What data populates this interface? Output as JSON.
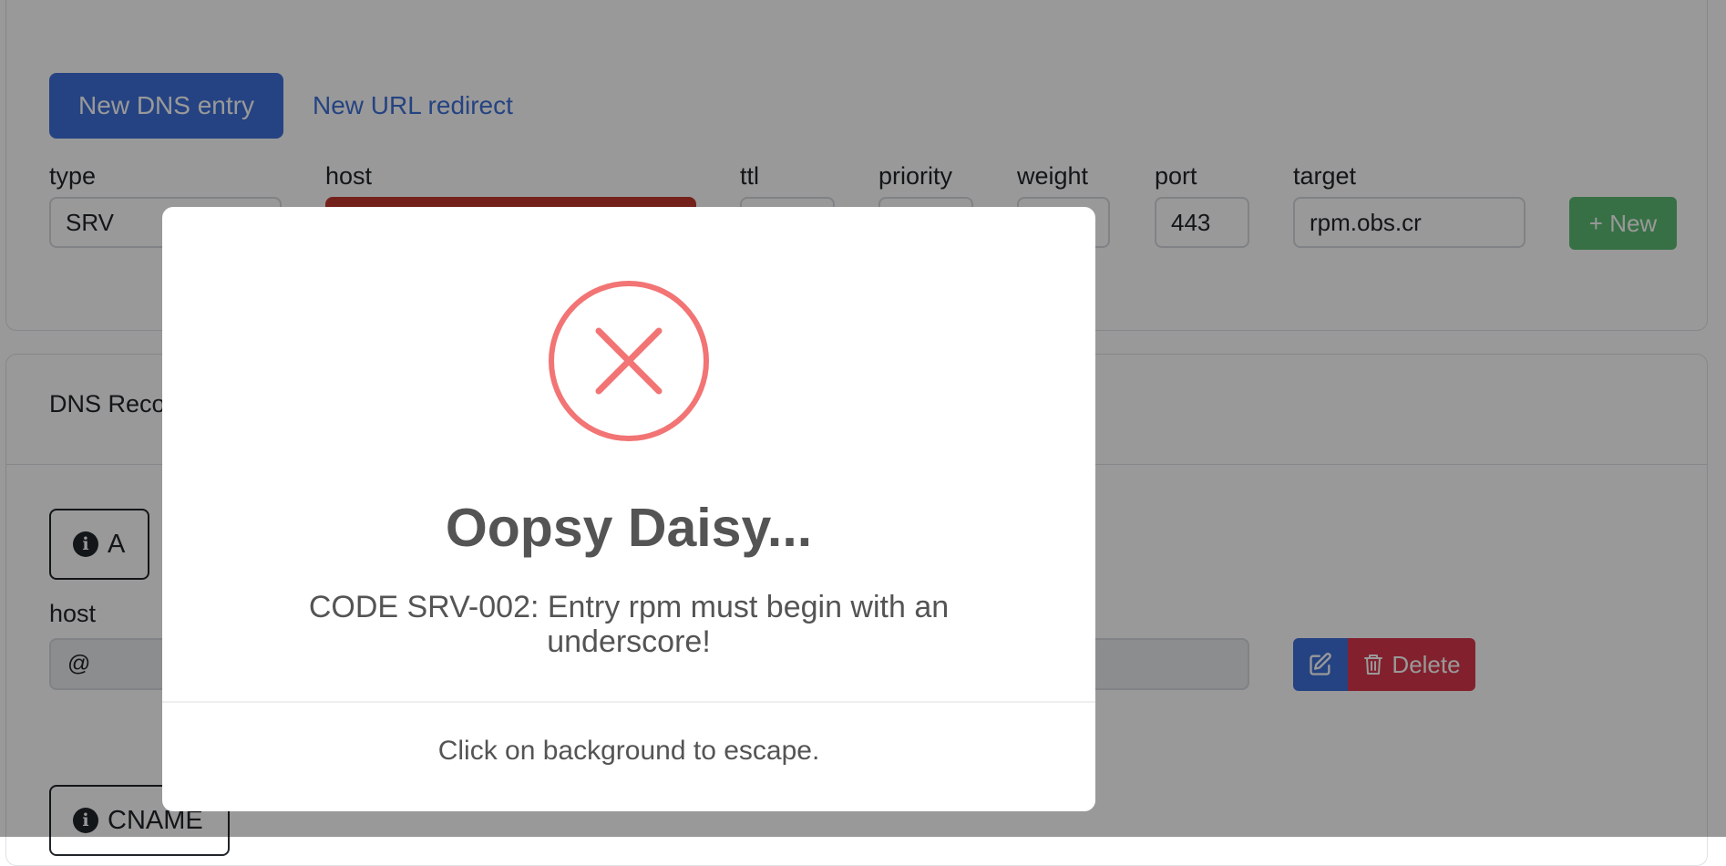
{
  "tabs": {
    "new_dns": "New DNS entry",
    "new_redirect": "New URL redirect"
  },
  "form": {
    "type_label": "type",
    "type_value": "SRV",
    "host_label": "host",
    "host_value": "",
    "ttl_label": "ttl",
    "ttl_value": "",
    "priority_label": "priority",
    "priority_value": "",
    "weight_label": "weight",
    "weight_value": "",
    "port_label": "port",
    "port_value": "443",
    "target_label": "target",
    "target_value": "rpm.obs.cr",
    "new_button": "+ New"
  },
  "records": {
    "section_title": "DNS Reco",
    "a_tag": "A",
    "host_label": "host",
    "host_value": "@",
    "delete_button": "Delete",
    "cname_tag": "CNAME"
  },
  "modal": {
    "title": "Oopsy Daisy...",
    "message": "CODE SRV-002: Entry rpm must begin with an underscore!",
    "footer": "Click on background to escape."
  },
  "colors": {
    "primary": "#3e71d9",
    "success": "#5cbb74",
    "danger": "#d9384b",
    "error_field": "#c4372d",
    "modal_icon": "#f27474"
  },
  "icons": [
    "info-icon",
    "edit-icon",
    "trash-icon",
    "error-x-icon"
  ]
}
